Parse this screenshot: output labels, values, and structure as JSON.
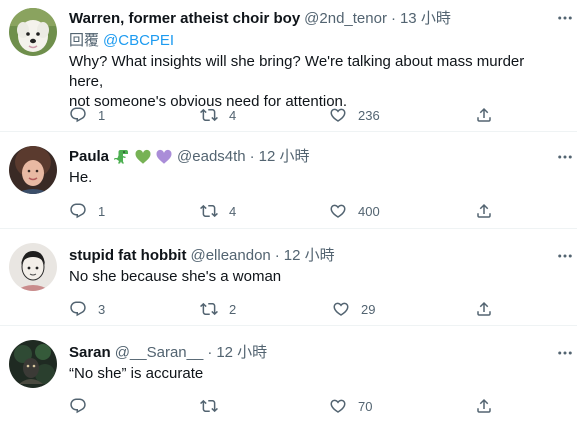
{
  "tweets": [
    {
      "display_name": "Warren, former atheist choir boy",
      "handle": "@2nd_tenor",
      "separator": "·",
      "time": "13 小時",
      "reply_prefix": "回覆",
      "reply_to": "@CBCPEI",
      "text_lines": [
        "Why? What insights will she bring? We're talking about mass murder here,",
        "not someone's obvious need for attention."
      ],
      "replies": "1",
      "retweets": "4",
      "likes": "236"
    },
    {
      "display_name": "Paula",
      "emojis": [
        "t-rex-emoji",
        "green-heart-emoji",
        "purple-heart-emoji"
      ],
      "handle": "@eads4th",
      "separator": "·",
      "time": "12 小時",
      "text_lines": [
        "He."
      ],
      "replies": "1",
      "retweets": "4",
      "likes": "400"
    },
    {
      "display_name": "stupid fat hobbit",
      "handle": "@elleandon",
      "separator": "·",
      "time": "12 小時",
      "text_lines": [
        "No she because she's a woman"
      ],
      "replies": "3",
      "retweets": "2",
      "likes": "29"
    },
    {
      "display_name": "Saran",
      "handle": "@__Saran__",
      "separator": "·",
      "time": "12 小時",
      "text_lines": [
        "“No she” is accurate"
      ],
      "replies": "",
      "retweets": "",
      "likes": "70"
    }
  ],
  "colors": {
    "text": "#0f1419",
    "secondary": "#536471",
    "link": "#1d9bf0",
    "divider": "#eff3f4"
  }
}
